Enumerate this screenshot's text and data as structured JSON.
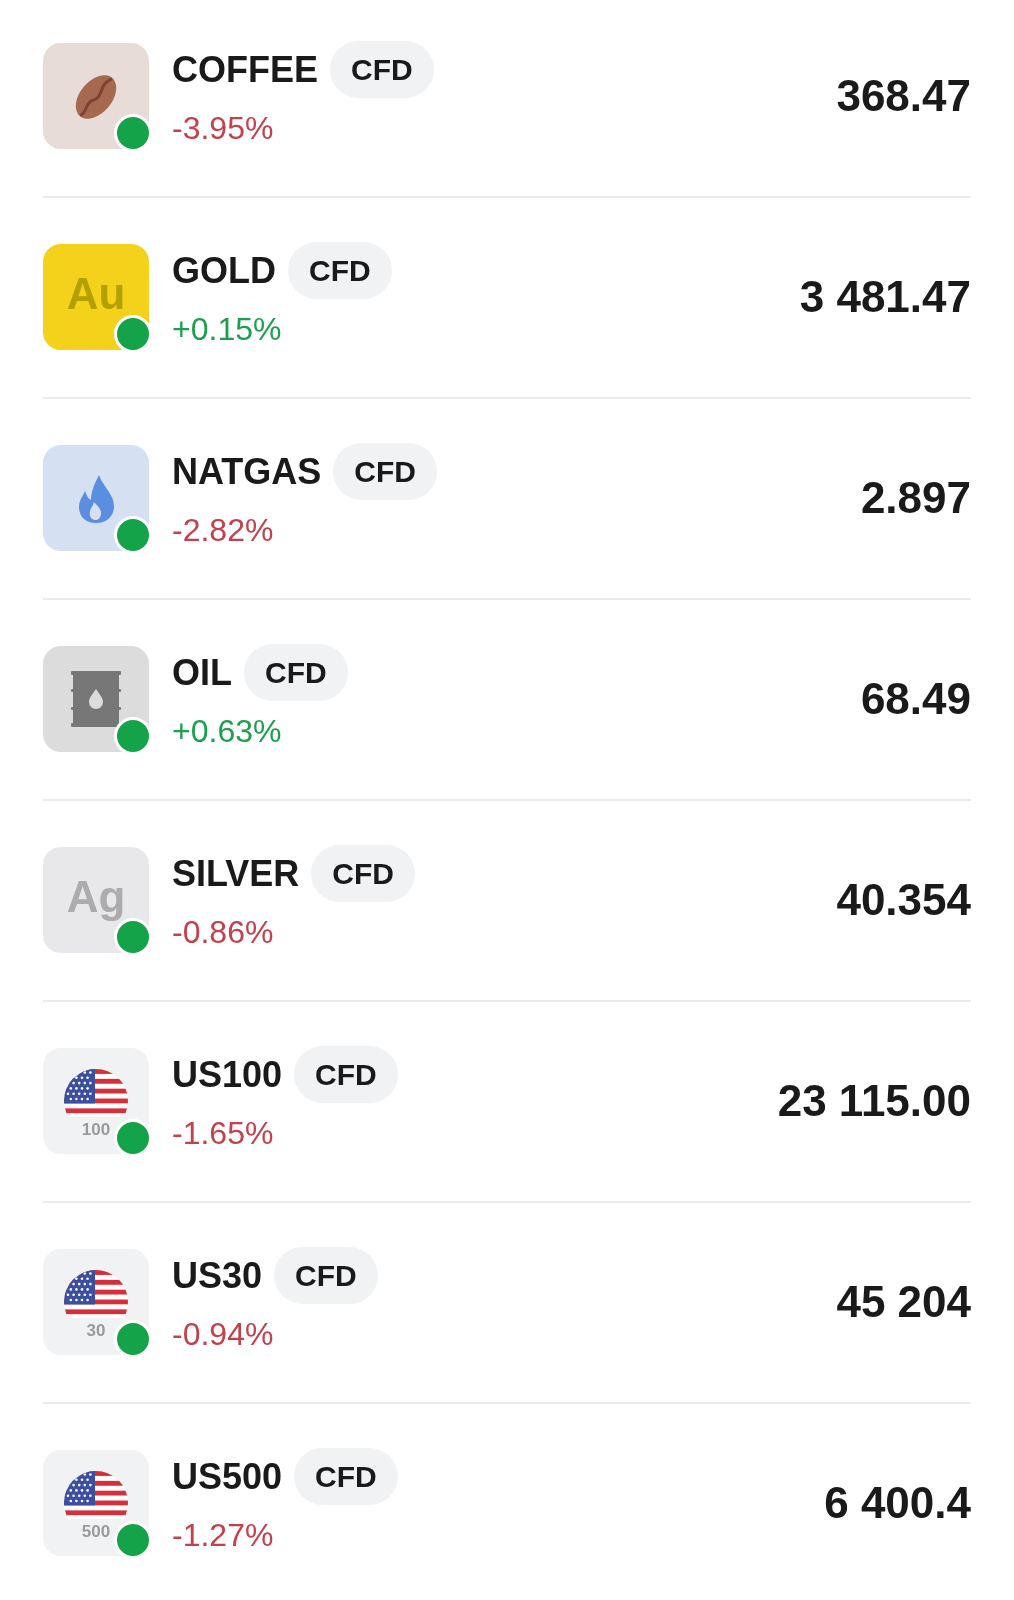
{
  "instruments": [
    {
      "name": "COFFEE",
      "badge": "CFD",
      "change": "-3.95%",
      "negative": true,
      "price": "368.47",
      "icon": {
        "kind": "coffee"
      },
      "color": "#15a34a"
    },
    {
      "name": "GOLD",
      "badge": "CFD",
      "change": "+0.15%",
      "negative": false,
      "price": "3 481.47",
      "icon": {
        "kind": "gold",
        "text": "Au"
      },
      "color": "#15a34a"
    },
    {
      "name": "NATGAS",
      "badge": "CFD",
      "change": "-2.82%",
      "negative": true,
      "price": "2.897",
      "icon": {
        "kind": "natgas"
      },
      "color": "#15a34a"
    },
    {
      "name": "OIL",
      "badge": "CFD",
      "change": "+0.63%",
      "negative": false,
      "price": "68.49",
      "icon": {
        "kind": "oil"
      },
      "color": "#15a34a"
    },
    {
      "name": "SILVER",
      "badge": "CFD",
      "change": "-0.86%",
      "negative": true,
      "price": "40.354",
      "icon": {
        "kind": "silver",
        "text": "Ag"
      },
      "color": "#15a34a"
    },
    {
      "name": "US100",
      "badge": "CFD",
      "change": "-1.65%",
      "negative": true,
      "price": "23 115.00",
      "icon": {
        "kind": "us-index",
        "text": "100"
      },
      "color": "#15a34a"
    },
    {
      "name": "US30",
      "badge": "CFD",
      "change": "-0.94%",
      "negative": true,
      "price": "45 204",
      "icon": {
        "kind": "us-index",
        "text": "30"
      },
      "color": "#15a34a"
    },
    {
      "name": "US500",
      "badge": "CFD",
      "change": "-1.27%",
      "negative": true,
      "price": "6 400.4",
      "icon": {
        "kind": "us-index",
        "text": "500"
      },
      "color": "#15a34a"
    }
  ]
}
